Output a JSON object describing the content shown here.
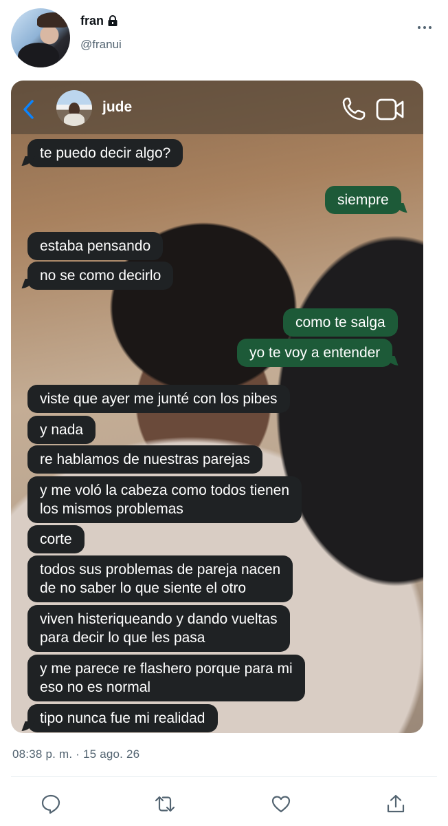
{
  "author": {
    "display_name": "fran",
    "handle": "@franui",
    "protected": true
  },
  "chat": {
    "contact_name": "jude",
    "messages": [
      {
        "from": "them",
        "text": "te puedo decir algo?"
      },
      {
        "from": "me",
        "text": "siempre"
      },
      {
        "from": "them",
        "text": "estaba pensando"
      },
      {
        "from": "them",
        "text": "no se como decirlo"
      },
      {
        "from": "me",
        "text": "como te salga"
      },
      {
        "from": "me",
        "text": "yo te voy a entender"
      },
      {
        "from": "them",
        "text": "viste que ayer me junté con los pibes"
      },
      {
        "from": "them",
        "text": "y nada"
      },
      {
        "from": "them",
        "text": "re hablamos de nuestras parejas"
      },
      {
        "from": "them",
        "text": "y me voló la cabeza como todos tienen\nlos mismos problemas"
      },
      {
        "from": "them",
        "text": "corte"
      },
      {
        "from": "them",
        "text": "todos sus problemas de pareja nacen\nde no saber lo que siente el otro"
      },
      {
        "from": "them",
        "text": "viven histeriqueando y dando vueltas\npara decir lo que les pasa"
      },
      {
        "from": "them",
        "text": "y me parece re flashero porque para mi\neso no es normal"
      },
      {
        "from": "them",
        "text": "tipo nunca fue mi realidad"
      }
    ]
  },
  "tweet": {
    "timestamp": "08:38 p. m. · 15 ago. 26"
  },
  "actions": [
    "reply-icon",
    "retweet-icon",
    "like-icon",
    "share-icon"
  ],
  "colors": {
    "incoming_bubble": "#1f2224",
    "outgoing_bubble": "#1d5a38",
    "ios_blue": "#0a84ff",
    "secondary_text": "#536471"
  }
}
